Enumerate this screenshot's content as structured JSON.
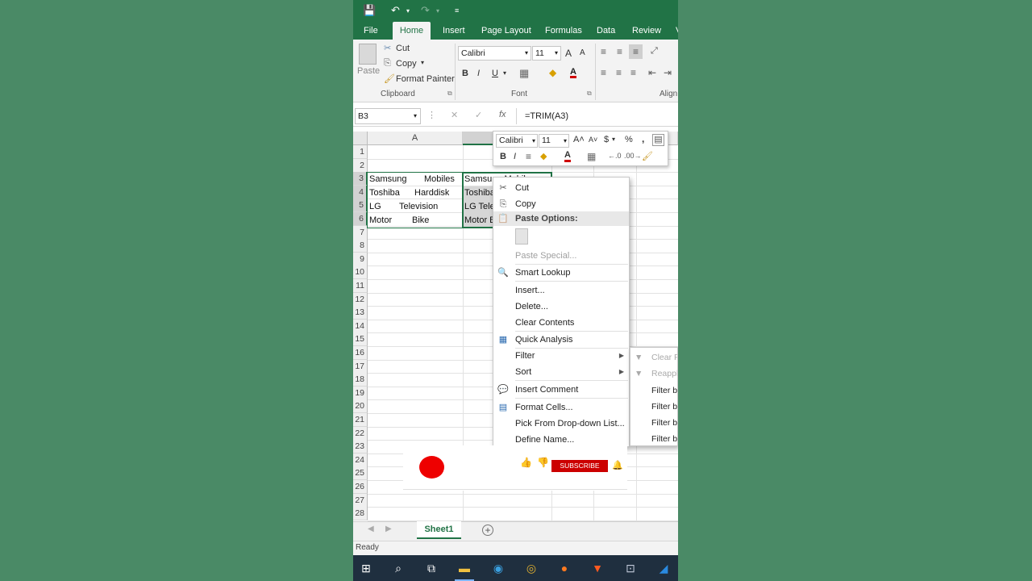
{
  "title_bar": {
    "save_icon": "save-icon",
    "undo_icon": "undo-icon",
    "redo_icon": "redo-icon",
    "customize_icon": "customize-qat-icon"
  },
  "tabs": [
    "File",
    "Home",
    "Insert",
    "Page Layout",
    "Formulas",
    "Data",
    "Review",
    "V"
  ],
  "active_tab": "Home",
  "ribbon": {
    "paste_label": "Paste",
    "cut_label": "Cut",
    "copy_label": "Copy",
    "format_painter_label": "Format Painter",
    "clipboard_group": "Clipboard",
    "font_name": "Calibri",
    "font_size": "11",
    "grow_font": "A",
    "shrink_font": "A",
    "bold": "B",
    "italic": "I",
    "underline": "U",
    "font_color_letter": "A",
    "font_group": "Font",
    "alignment_group": "Align"
  },
  "formula_bar": {
    "name_box": "B3",
    "cancel": "✕",
    "enter": "✓",
    "fx": "fx",
    "formula": "=TRIM(A3)"
  },
  "grid": {
    "columns": [
      "A"
    ],
    "rows": [
      "1",
      "2",
      "3",
      "4",
      "5",
      "6",
      "7",
      "8",
      "9",
      "10",
      "11",
      "12",
      "13",
      "14",
      "15",
      "16",
      "17",
      "18",
      "19",
      "20",
      "21",
      "22",
      "23",
      "24",
      "25",
      "26",
      "27",
      "28"
    ],
    "col_a": [
      {
        "row": 3,
        "left": "Samsung",
        "right": "Mobiles"
      },
      {
        "row": 4,
        "left": "Toshiba",
        "right": "Harddisk"
      },
      {
        "row": 5,
        "left": "LG",
        "right": "Television"
      },
      {
        "row": 6,
        "left": "Motor",
        "right": "Bike"
      }
    ],
    "col_b": [
      "Samsung Mobiles",
      "Toshiba",
      "LG Tele",
      "Motor B"
    ]
  },
  "mini_toolbar": {
    "font": "Calibri",
    "size": "11",
    "bold": "B",
    "italic": "I",
    "currency": "$",
    "percent": "%",
    "comma": ",",
    "font_color": "A"
  },
  "context_menu": [
    {
      "label": "Cut",
      "icon": "✂",
      "icon_name": "cut-icon",
      "disabled": false
    },
    {
      "label": "Copy",
      "icon": "⎘",
      "icon_name": "copy-icon",
      "disabled": false
    },
    {
      "label": "Paste Options:",
      "icon": "📋",
      "icon_name": "paste-options-icon",
      "heading": true
    },
    {
      "label": "Paste Special...",
      "disabled": true
    },
    {
      "label": "Smart Lookup",
      "icon": "🔍",
      "icon_name": "smart-lookup-icon"
    },
    {
      "label": "Insert..."
    },
    {
      "label": "Delete..."
    },
    {
      "label": "Clear Contents"
    },
    {
      "label": "Quick Analysis",
      "icon": "▦",
      "icon_name": "quick-analysis-icon"
    },
    {
      "label": "Filter",
      "submenu": true
    },
    {
      "label": "Sort",
      "submenu": true
    },
    {
      "label": "Insert Comment",
      "icon": "💬",
      "icon_name": "comment-icon"
    },
    {
      "label": "Format Cells...",
      "icon": "▤",
      "icon_name": "format-cells-icon"
    },
    {
      "label": "Pick From Drop-down List..."
    },
    {
      "label": "Define Name..."
    }
  ],
  "filter_submenu": [
    "Clear Fi",
    "Reapply",
    "Filter by",
    "Filter by",
    "Filter by",
    "Filter by"
  ],
  "overlay": {
    "subscribe": "SUBSCRIBE"
  },
  "sheet_tab": "Sheet1",
  "status": "Ready",
  "colors": {
    "excel_green": "#217346",
    "background": "#4a8a66",
    "subscribe_red": "#cc0000"
  }
}
